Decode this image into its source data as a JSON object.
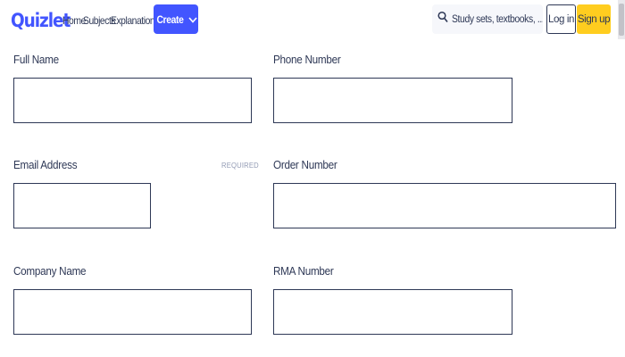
{
  "header": {
    "logo": "Quizlet",
    "nav": [
      "Home",
      "Subjects",
      "Explanations"
    ],
    "create_label": "Create",
    "search_placeholder": "Study sets, textbooks, ...",
    "login_label": "Log in",
    "signup_label": "Sign up"
  },
  "form": {
    "full_name": {
      "label": "Full Name",
      "value": ""
    },
    "phone_number": {
      "label": "Phone Number",
      "value": ""
    },
    "email_address": {
      "label": "Email Address",
      "required_tag": "REQUIRED",
      "value": ""
    },
    "order_number": {
      "label": "Order Number",
      "value": ""
    },
    "company_name": {
      "label": "Company Name",
      "value": ""
    },
    "rma_number": {
      "label": "RMA Number",
      "value": ""
    }
  },
  "colors": {
    "brand": "#4255ff",
    "signup": "#ffcd1f",
    "text": "#2e3856",
    "muted": "#939bb4"
  }
}
